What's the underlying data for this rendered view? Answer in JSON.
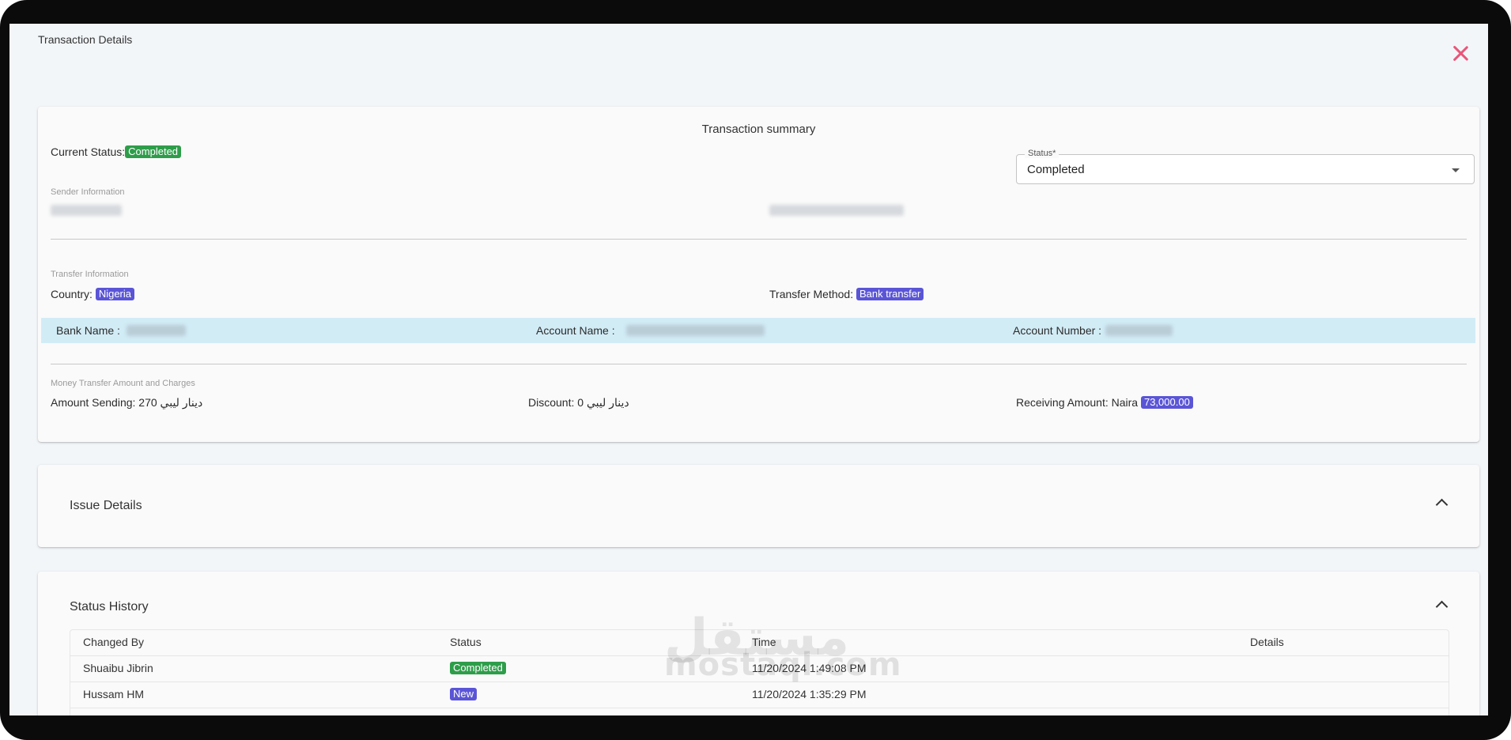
{
  "window": {
    "title": "Transaction Details",
    "close_icon": "close-icon"
  },
  "summary": {
    "title": "Transaction summary",
    "current_status_label": "Current Status:",
    "current_status_value": "Completed",
    "status_select": {
      "legend": "Status*",
      "value": "Completed"
    },
    "sender": {
      "section_label": "Sender Information"
    },
    "transfer": {
      "section_label": "Transfer Information",
      "country_label": "Country:",
      "country_value": "Nigeria",
      "method_label": "Transfer Method:",
      "method_value": "Bank transfer",
      "bank_name_label": "Bank Name :",
      "account_name_label": "Account Name :",
      "account_number_label": "Account Number :"
    },
    "amounts": {
      "section_label": "Money Transfer Amount and Charges",
      "sending": "Amount Sending: 270 دينار ليبي",
      "discount": "Discount: 0 دينار ليبي",
      "receiving_label": "Receiving Amount: Naira",
      "receiving_value": "73,000.00"
    }
  },
  "issue_details": {
    "title": "Issue Details"
  },
  "status_history": {
    "title": "Status History",
    "columns": [
      "Changed By",
      "Status",
      "Time",
      "Details"
    ],
    "rows": [
      {
        "changed_by": "Shuaibu  Jibrin",
        "status": "Completed",
        "time": "11/20/2024 1:49:08 PM",
        "details": ""
      },
      {
        "changed_by": "Hussam  HM",
        "status": "New",
        "time": "11/20/2024 1:35:29 PM",
        "details": ""
      }
    ]
  },
  "watermark": {
    "arabic": "مستقل",
    "latin": "mostaql.com"
  },
  "colors": {
    "completed": "#2e9d4a",
    "new": "#5a55d6",
    "close": "#e8567a",
    "highlight_row": "#d2ecf6"
  }
}
